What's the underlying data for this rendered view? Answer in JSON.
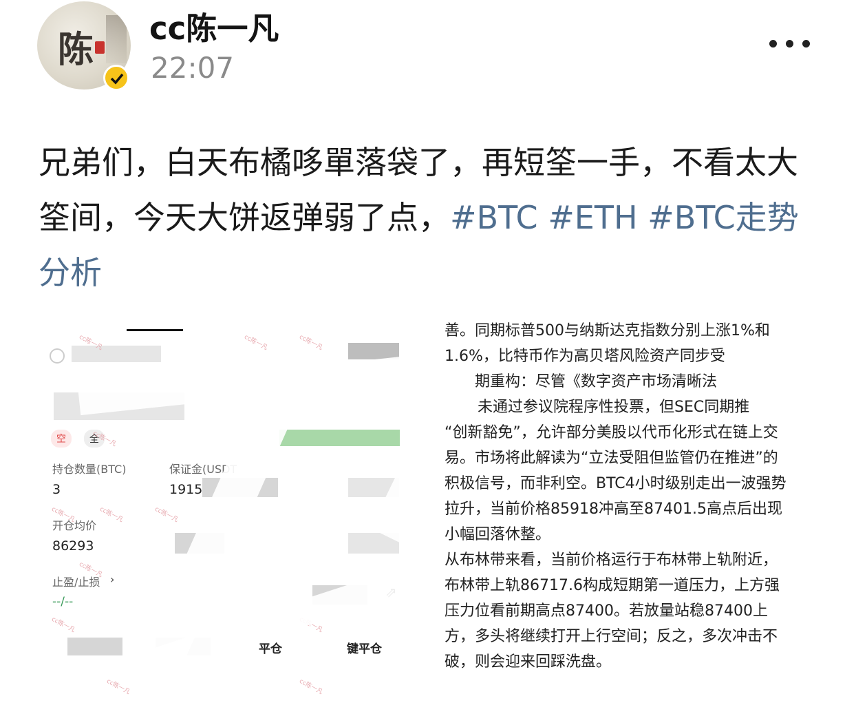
{
  "post": {
    "username": "cc陈一凡",
    "time": "22:07",
    "avatar_char": "陈",
    "text": "兄弟们，白天布橘哆單落袋了，再短筌一手，不看太大筌间，今天大饼返弹弱了点，",
    "tags": [
      "#BTC",
      "#ETH",
      "#BTC走势分析"
    ]
  },
  "screenshot": {
    "labels": {
      "position_qty": "持仓数量(BTC)",
      "margin": "保证金(USDT",
      "avg_price": "开仓均价",
      "tp_sl": "止盈/止损",
      "close": "平仓",
      "quick_close": "键平仓"
    },
    "values": {
      "qty": "3",
      "margin": "1915",
      "avg_price": "86293",
      "tp_sl": "--/--"
    },
    "chips": {
      "short": "空",
      "cross": "全"
    },
    "watermark": "cc陈一凡"
  },
  "article": {
    "paragraphs": [
      "善。同期标普500与纳斯达克指数分别上涨1%和1.6%，比特币作为高贝塔风险资产同步受",
      "期重构：尽管《数字资产市场清晰法",
      "未通过参议院程序性投票，但SEC同期推",
      "“创新豁免”，允许部分美股以代币化形式在链上交易。市场将此解读为“立法受阻但监管仍在推进”的积极信号，而非利空。BTC4小时级别走出一波强势拉升，当前价格85918冲高至87401.5高点后出现小幅回落休整。",
      "从布林带来看，当前价格运行于布林带上轨附近，布林带上轨86717.6构成短期第一道压力，上方强压力位看前期高点87400。若放量站稳87400上方，多头将继续打开上行空间；反之，多次冲击不破，则会迎来回踩洗盘。"
    ]
  }
}
